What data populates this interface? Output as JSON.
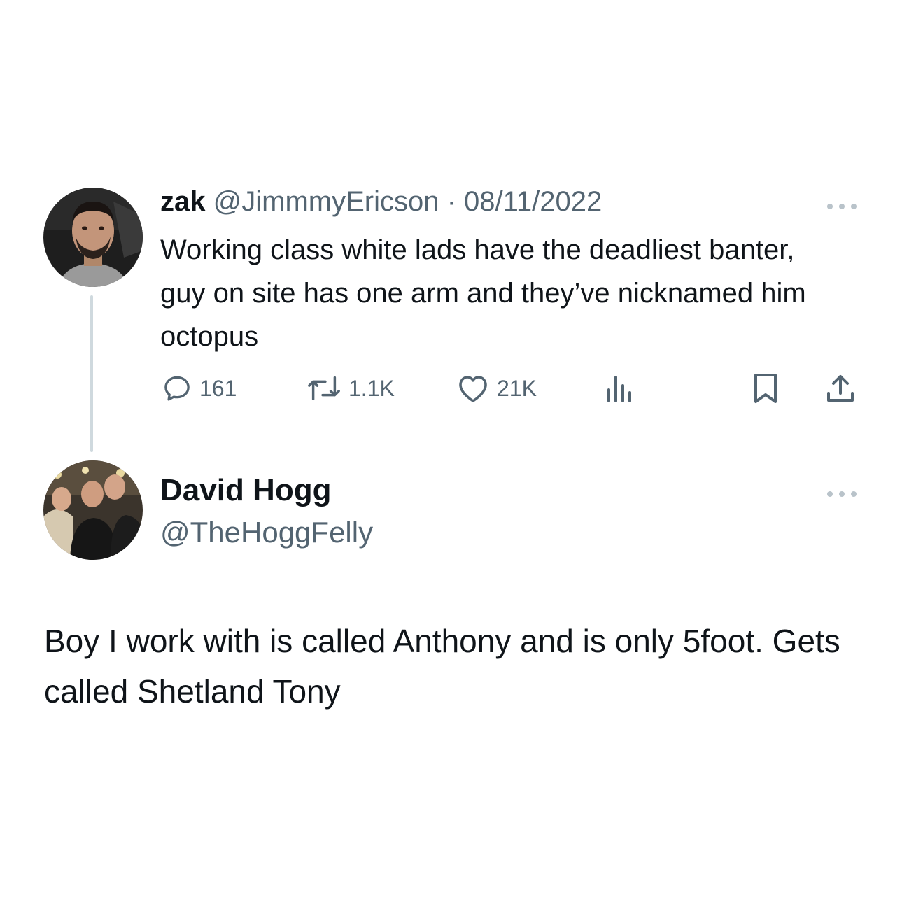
{
  "original_tweet": {
    "display_name": "zak",
    "handle": "@JimmmyEricson",
    "separator": "·",
    "date": "08/11/2022",
    "text": "Working class white lads have the deadliest banter, guy on site has one arm and they’ve nicknamed him octopus",
    "more_icon": "more-horizontal-icon",
    "actions": {
      "replies": "161",
      "retweets": "1.1K",
      "likes": "21K"
    }
  },
  "reply_tweet": {
    "display_name": "David Hogg",
    "handle": "@TheHoggFelly",
    "text": "Boy I work with is called Anthony and is only 5foot. Gets called Shetland Tony",
    "more_icon": "more-horizontal-icon"
  },
  "colors": {
    "text": "#0f1419",
    "muted": "#536471",
    "thread_line": "#cfd9de",
    "background": "#ffffff"
  }
}
